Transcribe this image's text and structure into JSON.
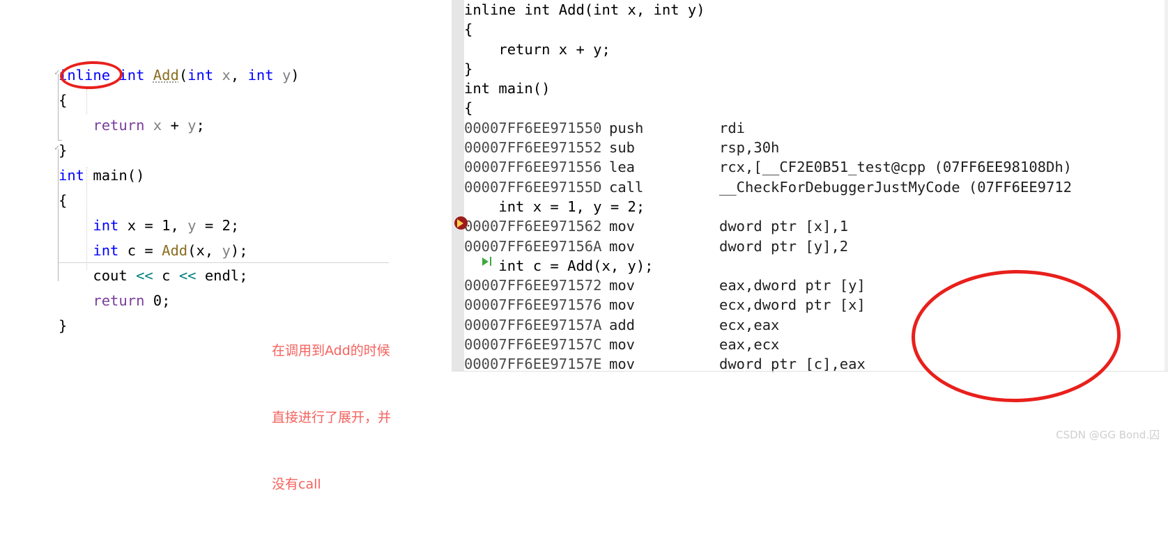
{
  "editor": {
    "source_lines": [
      {
        "indent": 0,
        "tokens": [
          {
            "t": "inline",
            "c": "kw"
          },
          {
            "t": " ",
            "c": ""
          },
          {
            "t": "int",
            "c": "kw"
          },
          {
            "t": " ",
            "c": ""
          },
          {
            "t": "Add",
            "c": "fn sq"
          },
          {
            "t": "(",
            "c": "op"
          },
          {
            "t": "int",
            "c": "kw"
          },
          {
            "t": " ",
            "c": ""
          },
          {
            "t": "x",
            "c": "var"
          },
          {
            "t": ", ",
            "c": "op"
          },
          {
            "t": "int",
            "c": "kw"
          },
          {
            "t": " ",
            "c": ""
          },
          {
            "t": "y",
            "c": "var"
          },
          {
            "t": ")",
            "c": "op"
          }
        ]
      },
      {
        "indent": 0,
        "tokens": [
          {
            "t": "{",
            "c": "op"
          }
        ]
      },
      {
        "indent": 1,
        "tokens": [
          {
            "t": "return",
            "c": "kw2"
          },
          {
            "t": " ",
            "c": ""
          },
          {
            "t": "x",
            "c": "var"
          },
          {
            "t": " + ",
            "c": "op"
          },
          {
            "t": "y",
            "c": "var"
          },
          {
            "t": ";",
            "c": "op"
          }
        ]
      },
      {
        "indent": 0,
        "tokens": [
          {
            "t": "}",
            "c": "op"
          }
        ]
      },
      {
        "indent": 0,
        "tokens": [
          {
            "t": "int",
            "c": "kw"
          },
          {
            "t": " ",
            "c": ""
          },
          {
            "t": "main",
            "c": "op"
          },
          {
            "t": "()",
            "c": "op"
          }
        ]
      },
      {
        "indent": 0,
        "tokens": [
          {
            "t": "{",
            "c": "op"
          }
        ]
      },
      {
        "indent": 1,
        "tokens": [
          {
            "t": "int",
            "c": "kw"
          },
          {
            "t": " ",
            "c": ""
          },
          {
            "t": "x",
            "c": "op"
          },
          {
            "t": " = ",
            "c": "op"
          },
          {
            "t": "1",
            "c": "num"
          },
          {
            "t": ", ",
            "c": "op"
          },
          {
            "t": "y",
            "c": "var"
          },
          {
            "t": " = ",
            "c": "op"
          },
          {
            "t": "2",
            "c": "num"
          },
          {
            "t": ";",
            "c": "op"
          }
        ]
      },
      {
        "indent": 1,
        "tokens": [
          {
            "t": "int",
            "c": "kw"
          },
          {
            "t": " ",
            "c": ""
          },
          {
            "t": "c",
            "c": "op"
          },
          {
            "t": " = ",
            "c": "op"
          },
          {
            "t": "Add",
            "c": "fn"
          },
          {
            "t": "(",
            "c": "op"
          },
          {
            "t": "x",
            "c": "op"
          },
          {
            "t": ", ",
            "c": "op"
          },
          {
            "t": "y",
            "c": "var"
          },
          {
            "t": ");",
            "c": "op"
          }
        ]
      },
      {
        "indent": 1,
        "tokens": [
          {
            "t": "cout",
            "c": "op"
          },
          {
            "t": " ",
            "c": ""
          },
          {
            "t": "<<",
            "c": "teal"
          },
          {
            "t": " c ",
            "c": "op"
          },
          {
            "t": "<<",
            "c": "teal"
          },
          {
            "t": " ",
            "c": ""
          },
          {
            "t": "endl",
            "c": "op"
          },
          {
            "t": ";",
            "c": "op"
          }
        ]
      },
      {
        "indent": 1,
        "tokens": [
          {
            "t": "return",
            "c": "kw2"
          },
          {
            "t": " ",
            "c": ""
          },
          {
            "t": "0",
            "c": "num"
          },
          {
            "t": ";",
            "c": "op"
          }
        ]
      },
      {
        "indent": 0,
        "tokens": [
          {
            "t": "}",
            "c": "op"
          }
        ]
      }
    ]
  },
  "annotation": {
    "line1": "在调用到Add的时候",
    "line2": "直接进行了展开，并",
    "line3": "没有call",
    "color": "#f4625e"
  },
  "highlights": {
    "inline_keyword_circle": "inline",
    "asm_block_circle": "inlined add instructions"
  },
  "disassembly": {
    "rows": [
      {
        "kind": "source",
        "text": "inline int Add(int x, int y)"
      },
      {
        "kind": "source",
        "text": "{"
      },
      {
        "kind": "source",
        "text": "    return x + y;"
      },
      {
        "kind": "source",
        "text": "}"
      },
      {
        "kind": "source",
        "text": "int main()"
      },
      {
        "kind": "source",
        "text": "{"
      },
      {
        "kind": "asm",
        "addr": "00007FF6EE971550",
        "mnem": "push",
        "oper": "rdi"
      },
      {
        "kind": "asm",
        "addr": "00007FF6EE971552",
        "mnem": "sub",
        "oper": "rsp,30h"
      },
      {
        "kind": "asm",
        "addr": "00007FF6EE971556",
        "mnem": "lea",
        "oper": "rcx,[__CF2E0B51_test@cpp (07FF6EE98108Dh)"
      },
      {
        "kind": "asm",
        "addr": "00007FF6EE97155D",
        "mnem": "call",
        "oper": "__CheckForDebuggerJustMyCode (07FF6EE9712"
      },
      {
        "kind": "source",
        "text": "    int x = 1, y = 2;"
      },
      {
        "kind": "asm",
        "addr": "00007FF6EE971562",
        "mnem": "mov",
        "oper": "dword ptr [x],1",
        "marker": "current-statement"
      },
      {
        "kind": "asm",
        "addr": "00007FF6EE97156A",
        "mnem": "mov",
        "oper": "dword ptr [y],2"
      },
      {
        "kind": "source",
        "text": "    int c = Add(x, y);",
        "marker": "run-to-cursor"
      },
      {
        "kind": "asm",
        "addr": "00007FF6EE971572",
        "mnem": "mov",
        "oper": "eax,dword ptr [y]"
      },
      {
        "kind": "asm",
        "addr": "00007FF6EE971576",
        "mnem": "mov",
        "oper": "ecx,dword ptr [x]"
      },
      {
        "kind": "asm",
        "addr": "00007FF6EE97157A",
        "mnem": "add",
        "oper": "ecx,eax"
      },
      {
        "kind": "asm",
        "addr": "00007FF6EE97157C",
        "mnem": "mov",
        "oper": "eax,ecx"
      },
      {
        "kind": "asm",
        "addr": "00007FF6EE97157E",
        "mnem": "mov",
        "oper": "dword ptr [c],eax"
      }
    ]
  },
  "watermark": {
    "text": "CSDN @GG Bond.囚"
  }
}
